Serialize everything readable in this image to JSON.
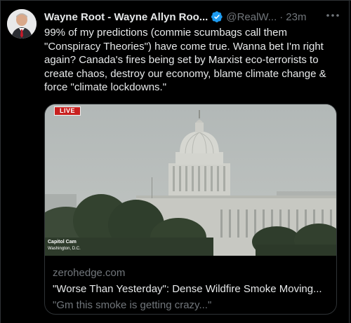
{
  "tweet": {
    "author_name": "Wayne Root - Wayne Allyn Roo...",
    "handle": "@RealW...",
    "separator": "·",
    "time": "23m",
    "text": "99% of my predictions (commie scumbags call them \"Conspiracy Theories\") have come true. Wanna bet I'm right again? Canada's fires being set by Marxist eco-terrorists to create chaos, destroy our economy, blame climate change & force \"climate lockdowns.\"",
    "verified_icon": "verified-badge-icon",
    "more_icon": "more-options-icon"
  },
  "card": {
    "live_badge": "LIVE",
    "cam_label": "Capitol Cam",
    "cam_location": "Washington, D.C.",
    "domain": "zerohedge.com",
    "title": "\"Worse Than Yesterday\": Dense Wildfire Smoke Moving...",
    "description": "\"Gm this smoke is getting crazy...\""
  },
  "colors": {
    "background": "#000000",
    "text_primary": "#e7e9ea",
    "text_secondary": "#71767b",
    "verified_blue": "#1d9bf0",
    "border": "#2f3336",
    "live_red": "#c8201f"
  }
}
